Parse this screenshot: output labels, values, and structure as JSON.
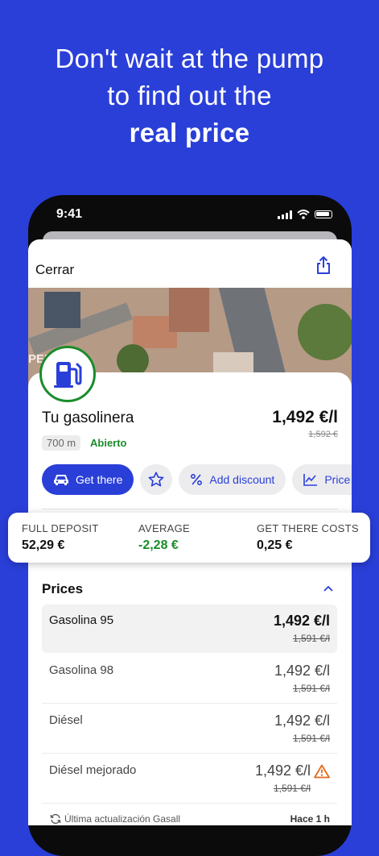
{
  "headline": {
    "line1": "Don't wait at the pump",
    "line2": "to find out the",
    "line3": "real price"
  },
  "status_bar": {
    "time": "9:41"
  },
  "sheet": {
    "close_label": "Cerrar"
  },
  "map": {
    "label": "PER"
  },
  "station": {
    "name": "Tu gasolinera",
    "price": "1,492 €/l",
    "old_price": "1,592 €",
    "distance": "700 m",
    "status": "Abierto"
  },
  "actions": {
    "get_there": "Get there",
    "add_discount": "Add discount",
    "price_history": "Price history"
  },
  "costs": {
    "full_deposit_label": "FULL DEPOSIT",
    "full_deposit_value": "52,29 €",
    "average_label": "AVERAGE",
    "average_value": "-2,28 €",
    "get_there_label": "GET THERE COSTS",
    "get_there_value": "0,25 €"
  },
  "prices": {
    "title": "Prices",
    "rows": [
      {
        "name": "Gasolina 95",
        "price": "1,492 €/l",
        "old": "1,591 €/l"
      },
      {
        "name": "Gasolina 98",
        "price": "1,492 €/l",
        "old": "1,591 €/l"
      },
      {
        "name": "Diésel",
        "price": "1,492 €/l",
        "old": "1,591 €/l"
      },
      {
        "name": "Diésel mejorado",
        "price": "1,492 €/l",
        "old": "1,591 €/l"
      }
    ]
  },
  "footer": {
    "update_label": "Última actualización Gasall",
    "update_time": "Hace 1 h"
  },
  "colors": {
    "brand_blue": "#2a3fd8",
    "open_green": "#1a8c2b",
    "warning_orange": "#e06a1b"
  }
}
